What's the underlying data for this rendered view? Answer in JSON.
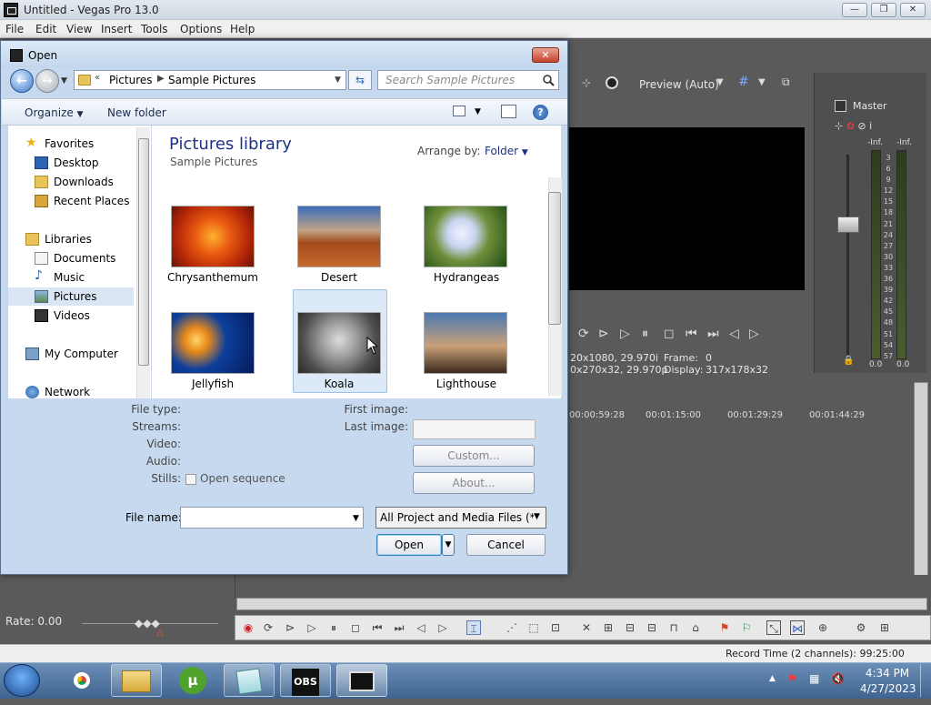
{
  "app": {
    "title": "Untitled - Vegas Pro 13.0"
  },
  "menu": [
    "File",
    "Edit",
    "View",
    "Insert",
    "Tools",
    "Options",
    "Help"
  ],
  "preview": {
    "mode_label": "Preview (Auto)",
    "info_left_1": "20x1080, 29.970i",
    "info_left_2": "0x270x32, 29.970p",
    "frame_label": "Frame:",
    "frame_value": "0",
    "display_label": "Display:",
    "display_value": "317x178x32"
  },
  "master": {
    "label": "Master",
    "peak_left": "-Inf.",
    "peak_right": "-Inf.",
    "scale": [
      "3",
      "6",
      "9",
      "12",
      "15",
      "18",
      "21",
      "24",
      "27",
      "30",
      "33",
      "36",
      "39",
      "42",
      "45",
      "48",
      "51",
      "54",
      "57"
    ],
    "bottom_left": "0.0",
    "bottom_right": "0.0"
  },
  "timeline": {
    "ruler": [
      "00:00:59:28",
      "00:01:15:00",
      "00:01:29:29",
      "00:01:44:29"
    ]
  },
  "rate": {
    "label": "Rate: 0.00"
  },
  "status": {
    "record_time": "Record Time (2 channels): 99:25:00"
  },
  "taskbar": {
    "time": "4:34 PM",
    "date": "4/27/2023"
  },
  "dialog": {
    "title": "Open",
    "close": "✕",
    "breadcrumb": [
      "Pictures",
      "Sample Pictures"
    ],
    "search_placeholder": "Search Sample Pictures",
    "organize": "Organize",
    "new_folder": "New folder",
    "nav": {
      "favorites": "Favorites",
      "desktop": "Desktop",
      "downloads": "Downloads",
      "recent": "Recent Places",
      "libraries": "Libraries",
      "documents": "Documents",
      "music": "Music",
      "pictures": "Pictures",
      "videos": "Videos",
      "computer": "My Computer",
      "network": "Network"
    },
    "library_title": "Pictures library",
    "library_subtitle": "Sample Pictures",
    "arrange_label": "Arrange by:",
    "arrange_value": "Folder",
    "files": [
      "Chrysanthemum",
      "Desert",
      "Hydrangeas",
      "Jellyfish",
      "Koala",
      "Lighthouse"
    ],
    "props": {
      "file_type": "File type:",
      "streams": "Streams:",
      "video": "Video:",
      "audio": "Audio:",
      "stills": "Stills:",
      "open_sequence": "Open sequence",
      "first_image": "First image:",
      "last_image": "Last image:"
    },
    "custom_btn": "Custom...",
    "about_btn": "About...",
    "filename_label": "File name:",
    "filename_value": "",
    "filetype_value": "All Project and Media Files (*.veg",
    "open_btn": "Open",
    "cancel_btn": "Cancel"
  }
}
